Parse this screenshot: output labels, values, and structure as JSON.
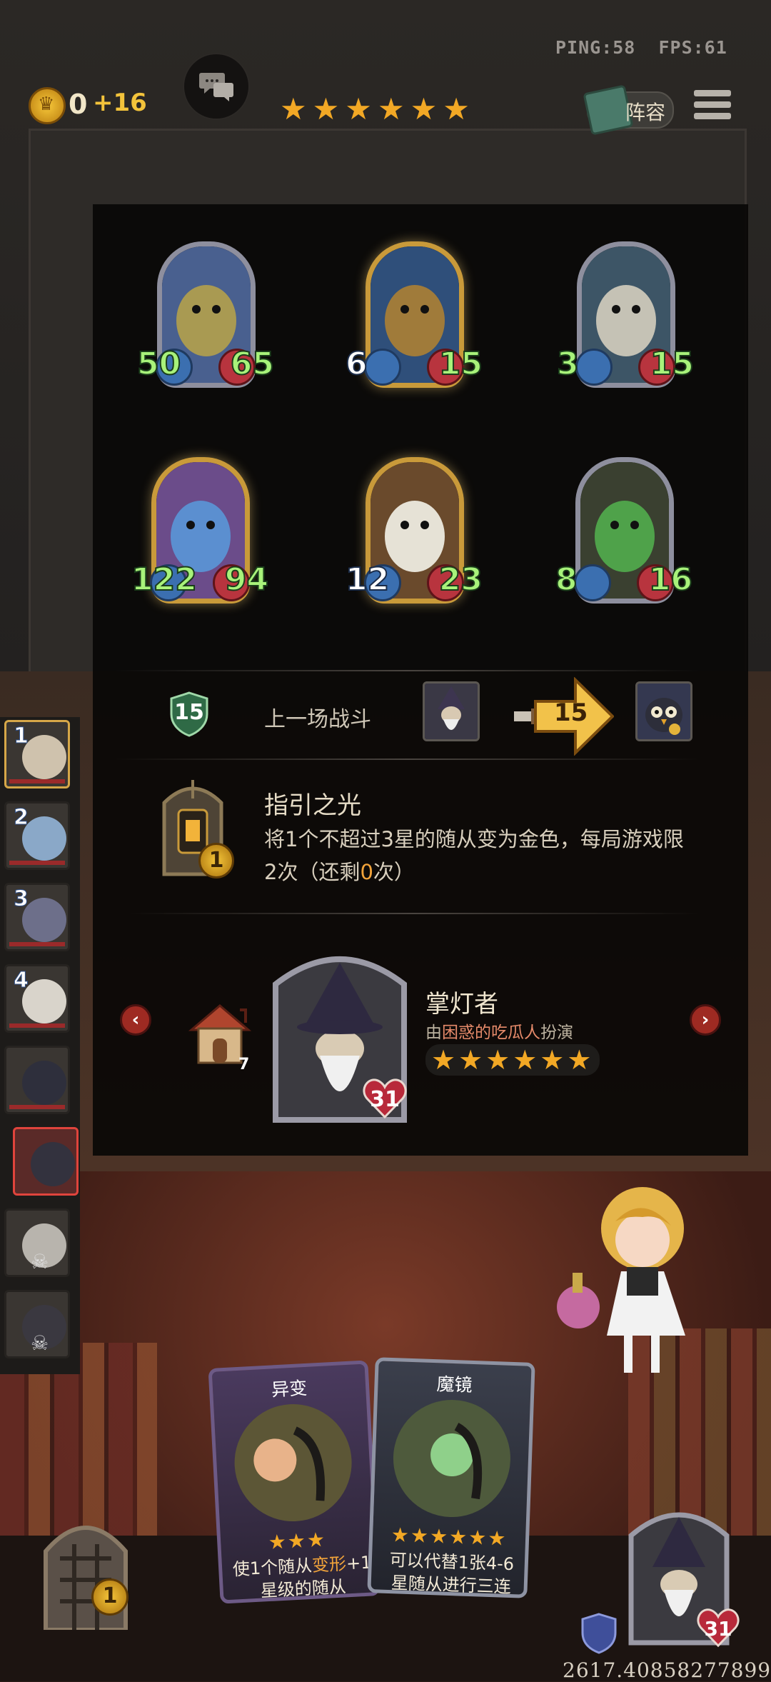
{
  "top_bar": {
    "ping": "PING:58",
    "fps": "FPS:61",
    "gold": "0",
    "gold_income": "+16",
    "tavern_stars": "★★★★★★",
    "roster_label": "阵容"
  },
  "minions": [
    {
      "attack": "50",
      "health": "65",
      "frame": "silver",
      "icon": "armored-drake-icon"
    },
    {
      "attack": "6",
      "health": "15",
      "frame": "gold",
      "icon": "mech-warrior-icon"
    },
    {
      "attack": "3",
      "health": "15",
      "frame": "silver",
      "icon": "bearded-beast-icon"
    },
    {
      "attack": "122",
      "health": "94",
      "frame": "gold",
      "icon": "blue-dragon-icon"
    },
    {
      "attack": "12",
      "health": "23",
      "frame": "gold",
      "icon": "white-serpent-dragon-icon"
    },
    {
      "attack": "8",
      "health": "16",
      "frame": "silver",
      "icon": "green-horned-dragon-icon"
    }
  ],
  "last_battle": {
    "tier": "15",
    "label": "上一场战斗",
    "damage": "15"
  },
  "hero_power": {
    "title": "指引之光",
    "cost": "1",
    "desc_a": "将1个不超过3星的随从变为金色，每局游戏限2次（还剩",
    "desc_remaining": "0",
    "desc_b": "次）"
  },
  "hero": {
    "name": "掌灯者",
    "played_by_prefix": "由",
    "player_name": "困惑的吃瓜人",
    "played_by_suffix": "扮演",
    "stars": "★★★★★★",
    "health": "31",
    "house_count": "7"
  },
  "nav": {
    "prev": "‹",
    "next": "›"
  },
  "rail": [
    {
      "num": "1",
      "state": "first"
    },
    {
      "num": "2",
      "state": "alive"
    },
    {
      "num": "3",
      "state": "alive"
    },
    {
      "num": "4",
      "state": "alive"
    },
    {
      "num": "",
      "state": "alive"
    },
    {
      "num": "",
      "state": "me"
    },
    {
      "num": "",
      "state": "dead"
    },
    {
      "num": "",
      "state": "dead"
    }
  ],
  "hand": [
    {
      "title": "异变",
      "stars": "★★★",
      "desc_a": "使1个随从",
      "desc_hl": "变形",
      "desc_b": "+1星级的随从"
    },
    {
      "title": "魔镜",
      "stars": "★★★★★★",
      "desc_a": "可以代替1张4-6星随从进行三连",
      "desc_hl": "",
      "desc_b": ""
    }
  ],
  "bottom": {
    "gate_cost": "1",
    "my_health": "31",
    "footer_number": "2617.40858277899"
  },
  "colors": {
    "accent_gold": "#f2a825",
    "highlight_orange": "#f1a33a",
    "stat_green": "#a8f27a"
  }
}
